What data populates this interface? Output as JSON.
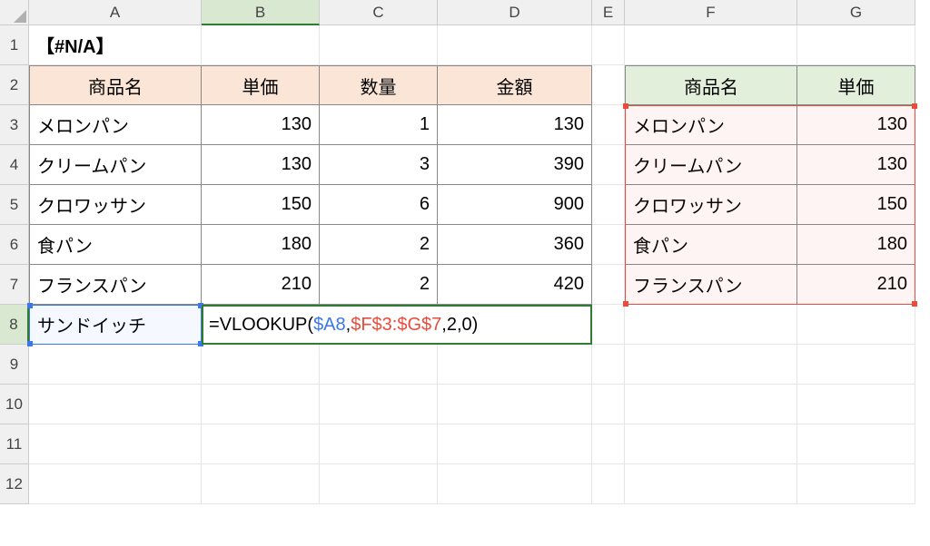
{
  "columns": [
    "A",
    "B",
    "C",
    "D",
    "E",
    "F",
    "G"
  ],
  "rows": [
    1,
    2,
    3,
    4,
    5,
    6,
    7,
    8,
    9,
    10,
    11,
    12
  ],
  "a1": "【#N/A】",
  "headers_left": {
    "a": "商品名",
    "b": "単価",
    "c": "数量",
    "d": "金額"
  },
  "headers_right": {
    "f": "商品名",
    "g": "単価"
  },
  "table_left": [
    {
      "a": "メロンパン",
      "b": "130",
      "c": "1",
      "d": "130"
    },
    {
      "a": "クリームパン",
      "b": "130",
      "c": "3",
      "d": "390"
    },
    {
      "a": "クロワッサン",
      "b": "150",
      "c": "6",
      "d": "900"
    },
    {
      "a": "食パン",
      "b": "180",
      "c": "2",
      "d": "360"
    },
    {
      "a": "フランスパン",
      "b": "210",
      "c": "2",
      "d": "420"
    }
  ],
  "table_right": [
    {
      "f": "メロンパン",
      "g": "130"
    },
    {
      "f": "クリームパン",
      "g": "130"
    },
    {
      "f": "クロワッサン",
      "g": "150"
    },
    {
      "f": "食パン",
      "g": "180"
    },
    {
      "f": "フランスパン",
      "g": "210"
    }
  ],
  "a8": "サンドイッチ",
  "formula": {
    "fn": "VLOOKUP",
    "ref1": "$A8",
    "ref2": "$F$3:$G$7",
    "col": "2",
    "match": "0"
  },
  "chart_data": {
    "type": "table",
    "title": "【#N/A】",
    "tables": [
      {
        "name": "left",
        "columns": [
          "商品名",
          "単価",
          "数量",
          "金額"
        ],
        "rows": [
          [
            "メロンパン",
            130,
            1,
            130
          ],
          [
            "クリームパン",
            130,
            3,
            390
          ],
          [
            "クロワッサン",
            150,
            6,
            900
          ],
          [
            "食パン",
            180,
            2,
            360
          ],
          [
            "フランスパン",
            210,
            2,
            420
          ],
          [
            "サンドイッチ",
            "=VLOOKUP($A8,$F$3:$G$7,2,0)",
            "",
            ""
          ]
        ]
      },
      {
        "name": "right",
        "columns": [
          "商品名",
          "単価"
        ],
        "rows": [
          [
            "メロンパン",
            130
          ],
          [
            "クリームパン",
            130
          ],
          [
            "クロワッサン",
            150
          ],
          [
            "食パン",
            180
          ],
          [
            "フランスパン",
            210
          ]
        ]
      }
    ]
  }
}
